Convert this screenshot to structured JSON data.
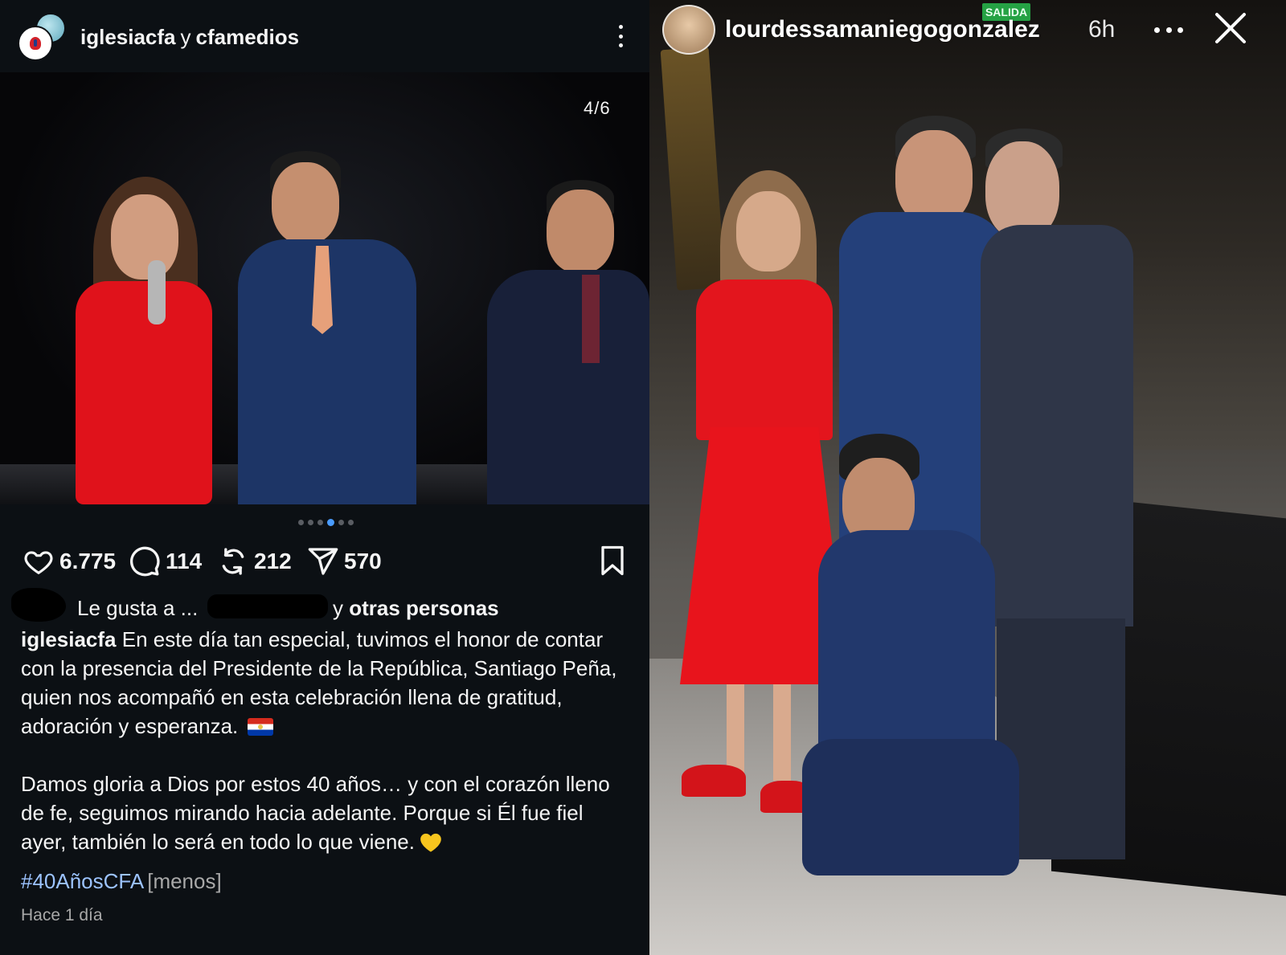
{
  "post": {
    "header": {
      "user_primary": "iglesiacfa",
      "connector": "y",
      "user_secondary": "cfamedios"
    },
    "carousel": {
      "counter": "4/6",
      "slide_count": 6,
      "active_slide": 4
    },
    "actions": {
      "likes": "6.775",
      "comments": "114",
      "reposts": "212",
      "shares": "570"
    },
    "liked_by": {
      "prefix": "Le gusta a",
      "redacted_name": "...",
      "suffix_text": "y",
      "suffix_bold": "otras personas"
    },
    "caption": {
      "author": "iglesiacfa",
      "paragraph1": "En este día tan especial, tuvimos el honor de contar con la presencia del Presidente de la República, Santiago Peña, quien nos acompañó en esta celebración llena de gratitud, adoración y esperanza.",
      "paragraph2": "Damos gloria a Dios por estos 40 años… y con el corazón lleno de fe, seguimos mirando hacia adelante. Porque si Él fue fiel ayer, también lo será en todo lo que viene.",
      "hashtag": "#40AñosCFA",
      "less_label": "[menos]",
      "timestamp": "Hace 1 día"
    }
  },
  "story": {
    "username": "lourdessamaniegogonzalez",
    "time": "6h",
    "exit_sign": "SALIDA"
  },
  "colors": {
    "post_bg": "#0c1014",
    "hashtag": "#9cc3ff",
    "active_dot": "#4a9cff",
    "dress_red": "#e0121b",
    "suit_navy": "#1d3566"
  },
  "icons": [
    "heart-icon",
    "comment-icon",
    "repost-icon",
    "share-icon",
    "bookmark-icon",
    "more-vertical-icon",
    "more-horizontal-icon",
    "close-icon",
    "paraguay-flag-icon",
    "yellow-heart-icon"
  ]
}
